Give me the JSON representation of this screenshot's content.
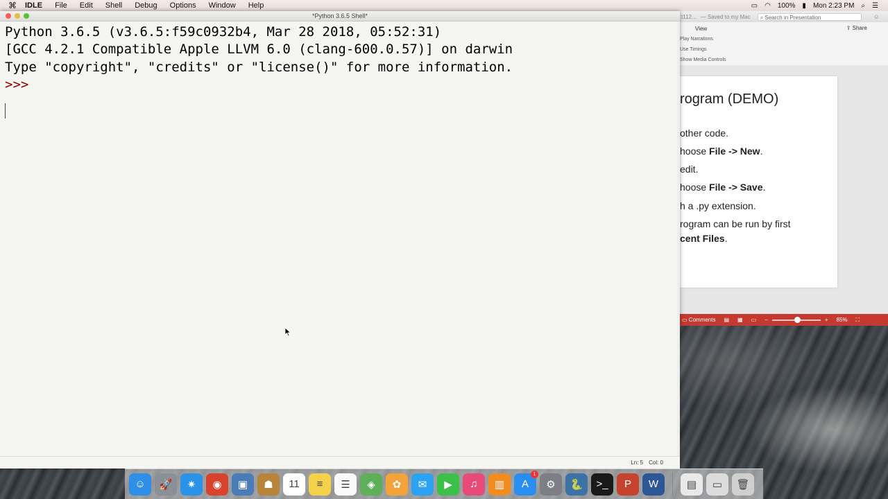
{
  "menubar": {
    "apple": "",
    "app_name": "IDLE",
    "menus": [
      "File",
      "Edit",
      "Shell",
      "Debug",
      "Options",
      "Window",
      "Help"
    ],
    "battery": "100%",
    "clock": "Mon 2:23 PM"
  },
  "idle": {
    "window_title": "*Python 3.6.5 Shell*",
    "lines": [
      "Python 3.6.5 (v3.6.5:f59c0932b4, Mar 28 2018, 05:52:31)",
      "[GCC 4.2.1 Compatible Apple LLVM 6.0 (clang-600.0.57)] on darwin",
      "Type \"copyright\", \"credits\" or \"license()\" for more information."
    ],
    "prompt": ">>>",
    "status_line": "Ln: 5",
    "status_col": "Col: 0"
  },
  "ppt": {
    "title_fragment": "t112...",
    "saved_text": "— Saved to my Mac",
    "search_placeholder": "Search in Presentation",
    "view_tab": "View",
    "share_label": "Share",
    "ribbon_items": [
      "Play Narrations",
      "Use Timings",
      "Show Media Controls"
    ],
    "slide": {
      "title": "rogram (DEMO)",
      "bullets": [
        {
          "pre": "other code.",
          "bold": "",
          "post": ""
        },
        {
          "pre": "hoose ",
          "bold": "File -> New",
          "post": "."
        },
        {
          "pre": " edit.",
          "bold": "",
          "post": ""
        },
        {
          "pre": "hoose ",
          "bold": "File -> Save",
          "post": "."
        },
        {
          "pre": "h a .py extension.",
          "bold": "",
          "post": ""
        },
        {
          "pre": "rogram can be run by first",
          "bold": "",
          "post": ""
        },
        {
          "pre": "",
          "bold": "cent Files",
          "post": "."
        }
      ]
    },
    "status": {
      "comments": "Comments",
      "zoom": "85%"
    }
  },
  "dock": {
    "apps": [
      {
        "name": "Finder",
        "glyph": "☺",
        "color": "#2f8ee8"
      },
      {
        "name": "Launchpad",
        "glyph": "🚀",
        "color": "#8a8f98"
      },
      {
        "name": "Safari",
        "glyph": "✷",
        "color": "#2a93e8"
      },
      {
        "name": "Chrome",
        "glyph": "◉",
        "color": "#d9422c"
      },
      {
        "name": "Preview",
        "glyph": "▣",
        "color": "#4a7cb8"
      },
      {
        "name": "Contacts",
        "glyph": "☗",
        "color": "#b8843a"
      },
      {
        "name": "Calendar",
        "glyph": "11",
        "color": "#ffffff"
      },
      {
        "name": "Notes",
        "glyph": "≡",
        "color": "#f3d24a"
      },
      {
        "name": "Reminders",
        "glyph": "☰",
        "color": "#fafafa"
      },
      {
        "name": "Maps",
        "glyph": "◈",
        "color": "#5fae5a"
      },
      {
        "name": "Photos",
        "glyph": "✿",
        "color": "#f4a23a"
      },
      {
        "name": "Messages",
        "glyph": "✉",
        "color": "#2ca2f2"
      },
      {
        "name": "FaceTime",
        "glyph": "▶",
        "color": "#3cc04a"
      },
      {
        "name": "iTunes",
        "glyph": "♫",
        "color": "#e84b7a"
      },
      {
        "name": "iBooks",
        "glyph": "▥",
        "color": "#f28b20"
      },
      {
        "name": "App Store",
        "glyph": "A",
        "color": "#2a8ef0",
        "badge": "1"
      },
      {
        "name": "System Preferences",
        "glyph": "⚙",
        "color": "#7d7f85"
      },
      {
        "name": "Python Launcher",
        "glyph": "🐍",
        "color": "#3b73a8"
      },
      {
        "name": "Terminal",
        "glyph": ">_",
        "color": "#1a1a1a"
      },
      {
        "name": "PowerPoint",
        "glyph": "P",
        "color": "#c6442d"
      },
      {
        "name": "Word",
        "glyph": "W",
        "color": "#2b5797"
      }
    ],
    "trailing": [
      {
        "name": "Document",
        "glyph": "▤",
        "color": "#e9e9e9"
      },
      {
        "name": "Downloads",
        "glyph": "▭",
        "color": "#dcdcdc"
      },
      {
        "name": "Trash",
        "glyph": "🗑",
        "color": "#cfcfcf"
      }
    ]
  }
}
